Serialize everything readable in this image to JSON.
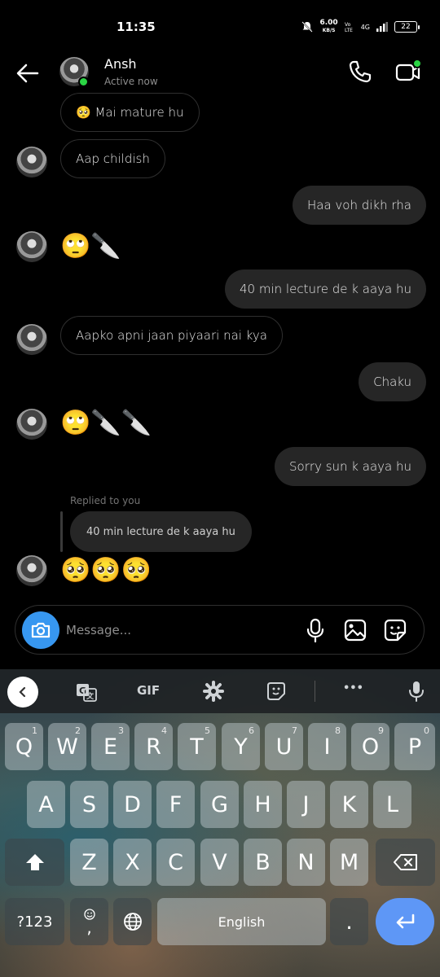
{
  "status_bar": {
    "time": "11:35",
    "speed_value": "6.00",
    "speed_unit": "KB/S",
    "network": "4G",
    "battery": "22"
  },
  "header": {
    "contact_name": "Ansh",
    "contact_status": "Active now"
  },
  "messages": [
    {
      "side": "in",
      "text": "🥺 Mai mature hu"
    },
    {
      "side": "in",
      "text": "Aap childish"
    },
    {
      "side": "out",
      "text": "Haa voh dikh rha"
    },
    {
      "side": "in",
      "text": "🙄🔪"
    },
    {
      "side": "out",
      "text": "40 min lecture de k aaya hu"
    },
    {
      "side": "in",
      "text": "Aapko apni jaan piyaari nai kya"
    },
    {
      "side": "out",
      "text": "Chaku"
    },
    {
      "side": "in",
      "text": "🙄🔪🔪"
    },
    {
      "side": "out",
      "text": "Sorry sun k aaya hu"
    },
    {
      "side": "in",
      "reply_label": "Replied to you",
      "quoted": "40 min lecture de k aaya hu",
      "text": "🥺🥺🥺"
    }
  ],
  "composer": {
    "placeholder": "Message..."
  },
  "keyboard": {
    "toolbar": {
      "gif": "GIF",
      "more": "•••"
    },
    "row1": [
      {
        "k": "Q",
        "n": "1"
      },
      {
        "k": "W",
        "n": "2"
      },
      {
        "k": "E",
        "n": "3"
      },
      {
        "k": "R",
        "n": "4"
      },
      {
        "k": "T",
        "n": "5"
      },
      {
        "k": "Y",
        "n": "6"
      },
      {
        "k": "U",
        "n": "7"
      },
      {
        "k": "I",
        "n": "8"
      },
      {
        "k": "O",
        "n": "9"
      },
      {
        "k": "P",
        "n": "0"
      }
    ],
    "row2": [
      "A",
      "S",
      "D",
      "F",
      "G",
      "H",
      "J",
      "K",
      "L"
    ],
    "row3": [
      "Z",
      "X",
      "C",
      "V",
      "B",
      "N",
      "M"
    ],
    "symbols_key": "?123",
    "comma_key": ",",
    "space_label": "English",
    "period_key": "."
  },
  "colors": {
    "accent_blue": "#3797f0",
    "online_green": "#2bd544",
    "enter_blue": "#5e97f6",
    "bubble_out": "#262626"
  }
}
